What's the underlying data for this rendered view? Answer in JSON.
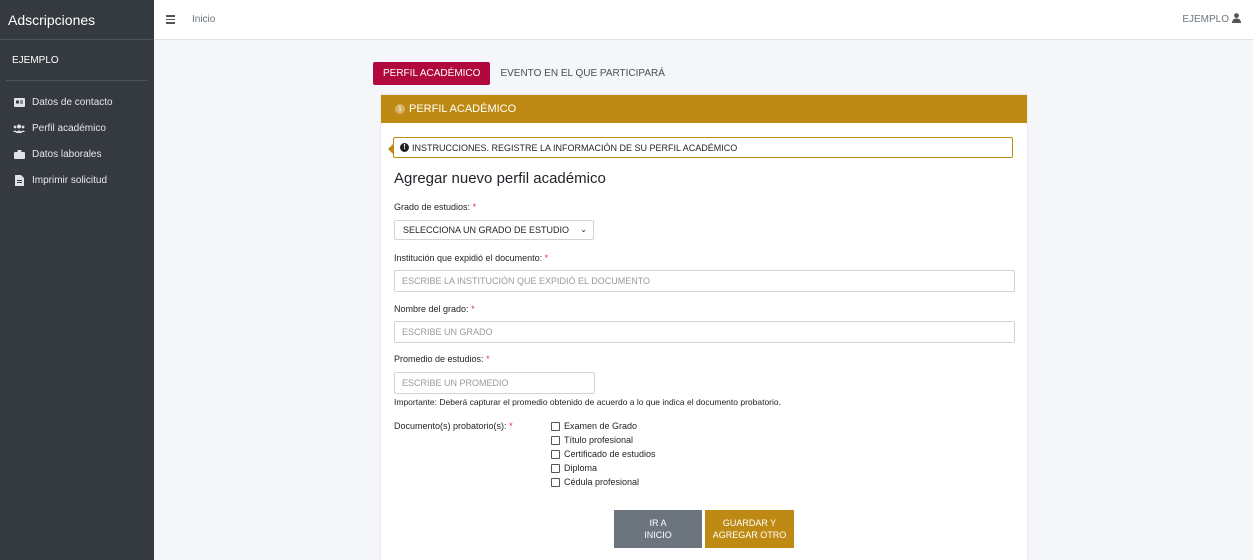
{
  "sidebar": {
    "brand": "Adscripciones",
    "user": "EJEMPLO",
    "items": [
      {
        "label": "Datos de contacto",
        "icon": "id-card-icon"
      },
      {
        "label": "Perfil académico",
        "icon": "users-icon"
      },
      {
        "label": "Datos laborales",
        "icon": "briefcase-icon"
      },
      {
        "label": "Imprimir solicitud",
        "icon": "file-pdf-icon"
      }
    ]
  },
  "topbar": {
    "home": "Inicio",
    "user": "EJEMPLO"
  },
  "tabs": [
    {
      "label": "PERFIL ACADÉMICO",
      "active": true
    },
    {
      "label": "EVENTO EN EL QUE PARTICIPARÁ",
      "active": false
    }
  ],
  "card": {
    "step": "1",
    "header": "PERFIL ACADÉMICO",
    "instructions": "INSTRUCCIONES. REGISTRE LA INFORMACIÓN DE SU PERFIL ACADÉMICO",
    "title": "Agregar nuevo perfil académico"
  },
  "form": {
    "grado": {
      "label": "Grado de estudios:",
      "value": "SELECCIONA UN GRADO DE ESTUDIO"
    },
    "institucion": {
      "label": "Institución que expidió el documento:",
      "placeholder": "ESCRIBE LA INSTITUCIÓN QUE EXPIDIÓ EL DOCUMENTO"
    },
    "nombre": {
      "label": "Nombre del grado:",
      "placeholder": "ESCRIBE UN GRADO"
    },
    "promedio": {
      "label": "Promedio de estudios:",
      "placeholder": "ESCRIBE UN PROMEDIO"
    },
    "note": "Importante: Deberá capturar el promedio obtenido de acuerdo a lo que indica el documento probatorio.",
    "documentos": {
      "label": "Documento(s) probatorio(s):",
      "options": [
        "Examen de Grado",
        "Título profesional",
        "Certificado de estudios",
        "Diploma",
        "Cédula profesional"
      ]
    },
    "required_mark": "*"
  },
  "buttons": {
    "home_line1": "IR A",
    "home_line2": "INICIO",
    "save_line1": "GUARDAR Y",
    "save_line2": "AGREGAR OTRO"
  },
  "colors": {
    "accent": "#bf8a14",
    "tab_active": "#b1093e",
    "sidebar": "#343a40",
    "secondary_button": "#6c757d"
  }
}
